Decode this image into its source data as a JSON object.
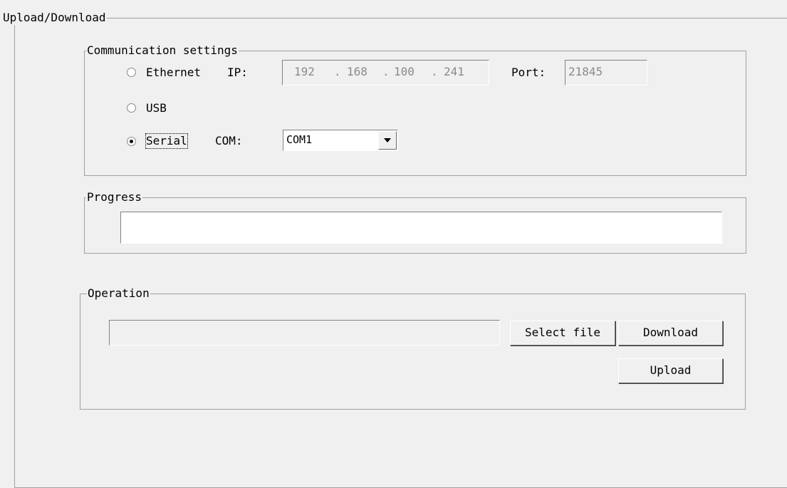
{
  "upload_download": {
    "title": "Upload/Download",
    "communication": {
      "title": "Communication settings",
      "ethernet": {
        "label": "Ethernet",
        "selected": false,
        "ip_label": "IP:",
        "ip_segments": [
          "192",
          ".",
          "168",
          ".",
          "100",
          ".",
          "241"
        ],
        "port_label": "Port:",
        "port_value": "21845"
      },
      "usb": {
        "label": "USB",
        "selected": false
      },
      "serial": {
        "label": "Serial",
        "selected": true,
        "com_label": "COM:",
        "com_value": "COM1"
      }
    },
    "progress": {
      "title": "Progress",
      "value": 0
    },
    "operation": {
      "title": "Operation",
      "file_path": "",
      "select_file_label": "Select file",
      "download_label": "Download",
      "upload_label": "Upload"
    }
  },
  "icons": [
    "radio-icon",
    "dropdown-arrow-icon"
  ]
}
